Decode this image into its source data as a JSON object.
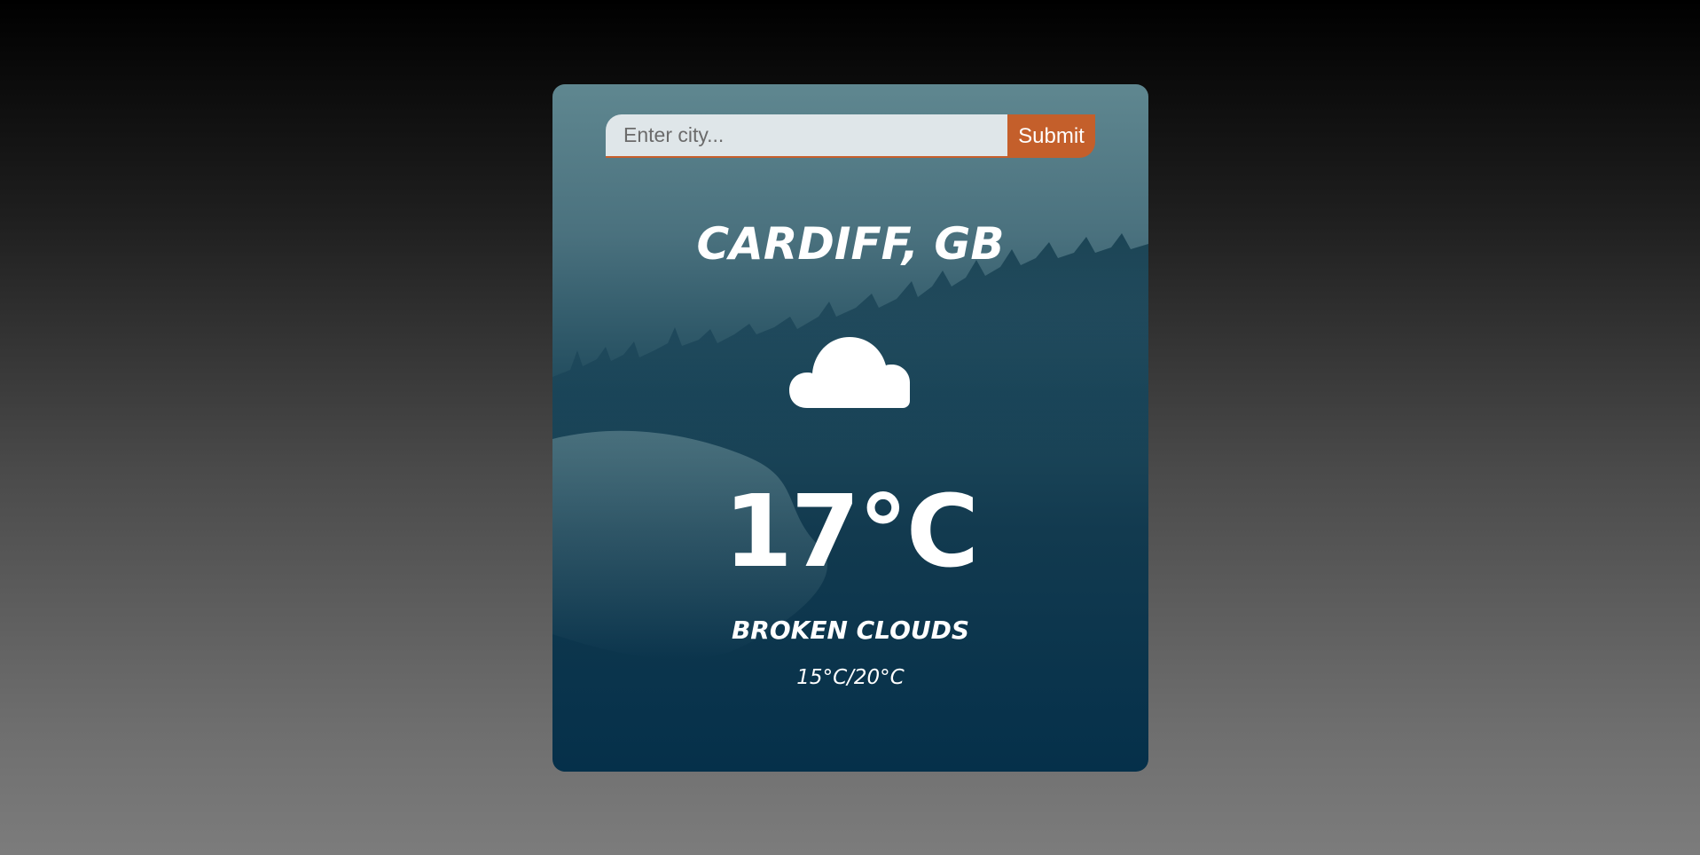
{
  "search": {
    "placeholder": "Enter city...",
    "value": "",
    "submit_label": "Submit"
  },
  "weather": {
    "location": "CARDIFF, GB",
    "icon": "cloud-icon",
    "temperature": "17°C",
    "description": "BROKEN CLOUDS",
    "range": "15°C/20°C"
  },
  "colors": {
    "accent": "#c45f2b",
    "card_top": "#5f8790",
    "card_bottom": "#05304a",
    "text": "#ffffff"
  }
}
